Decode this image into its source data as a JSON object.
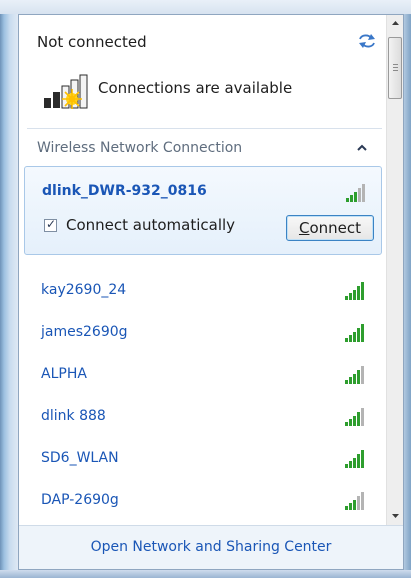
{
  "header": {
    "status": "Not connected",
    "availability": "Connections are available"
  },
  "section": {
    "title": "Wireless Network Connection"
  },
  "selected": {
    "name": "dlink_DWR-932_0816",
    "connect_automatically_label": "Connect automatically",
    "connect_automatically_checked": true,
    "connect_button": {
      "label_accel": "C",
      "label_rest": "onnect"
    }
  },
  "networks": [
    {
      "name": "kay2690_24"
    },
    {
      "name": "james2690g"
    },
    {
      "name": "ALPHA"
    },
    {
      "name": "dlink 888"
    },
    {
      "name": "SD6_WLAN"
    },
    {
      "name": "DAP-2690g"
    }
  ],
  "footer": {
    "link": "Open Network and Sharing Center"
  },
  "colors": {
    "link": "#1a56b6",
    "signal_green": "#2e9e2e",
    "signal_gray": "#b4b4b4"
  }
}
